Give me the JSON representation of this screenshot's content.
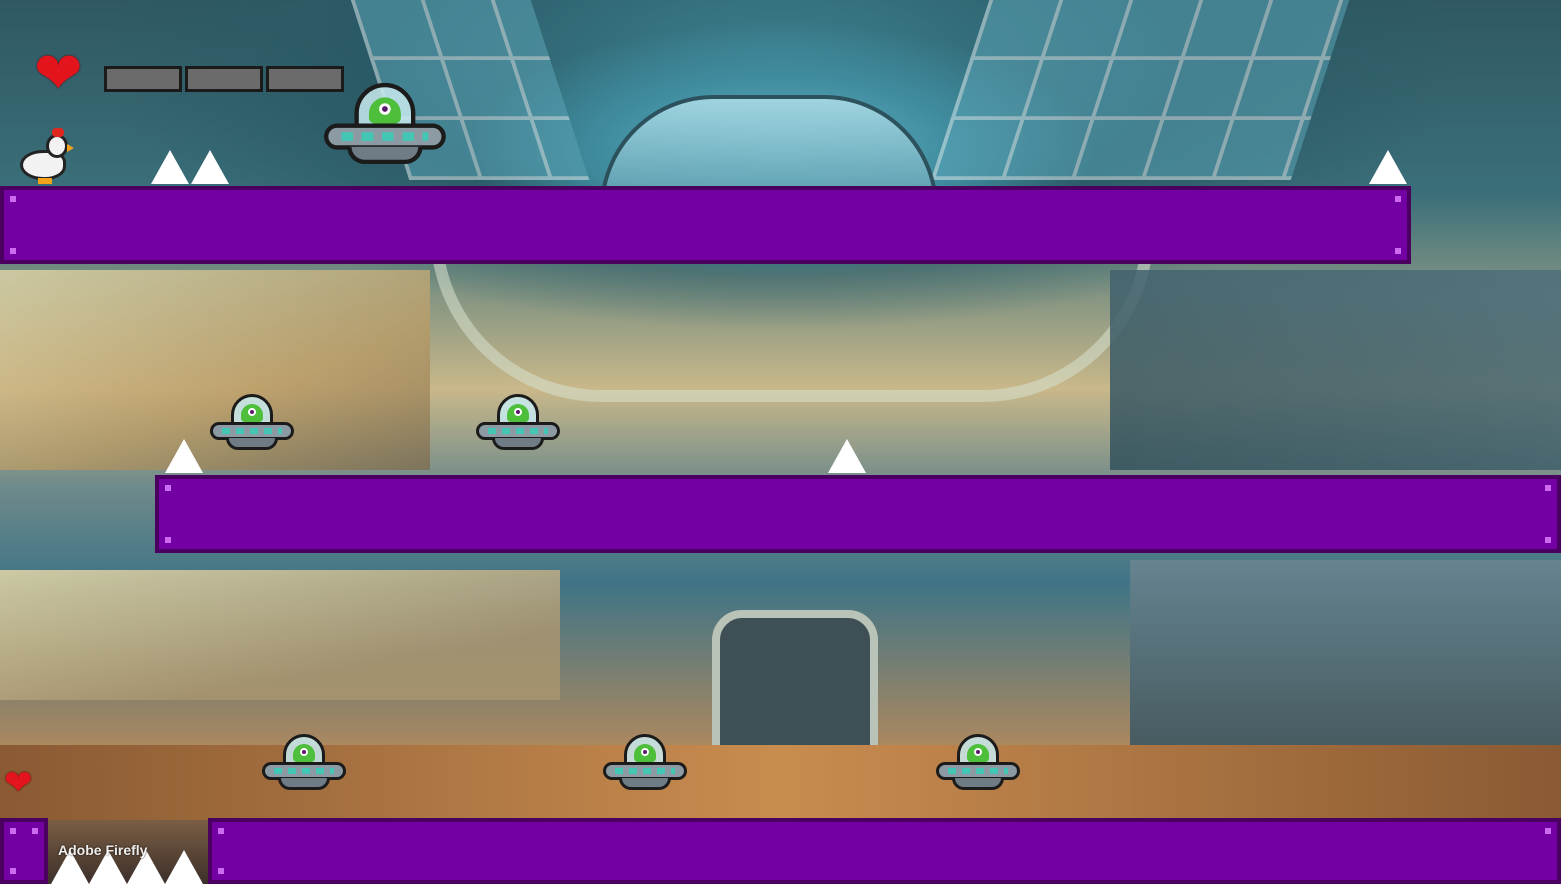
{
  "hud": {
    "health": {
      "heart_icon": "heart-icon",
      "segments_total": 3,
      "segment_color": "#6b6b6b"
    },
    "lives_icon": "heart-icon"
  },
  "player": {
    "sprite": "chicken-icon"
  },
  "enemies": {
    "sprite": "ufo-alien-icon",
    "count": 6
  },
  "hazards": {
    "sprite": "spike-icon",
    "count": 9
  },
  "platforms": {
    "color": "#7200a2",
    "count": 4
  },
  "watermark": {
    "text": "Adobe Firefly"
  }
}
